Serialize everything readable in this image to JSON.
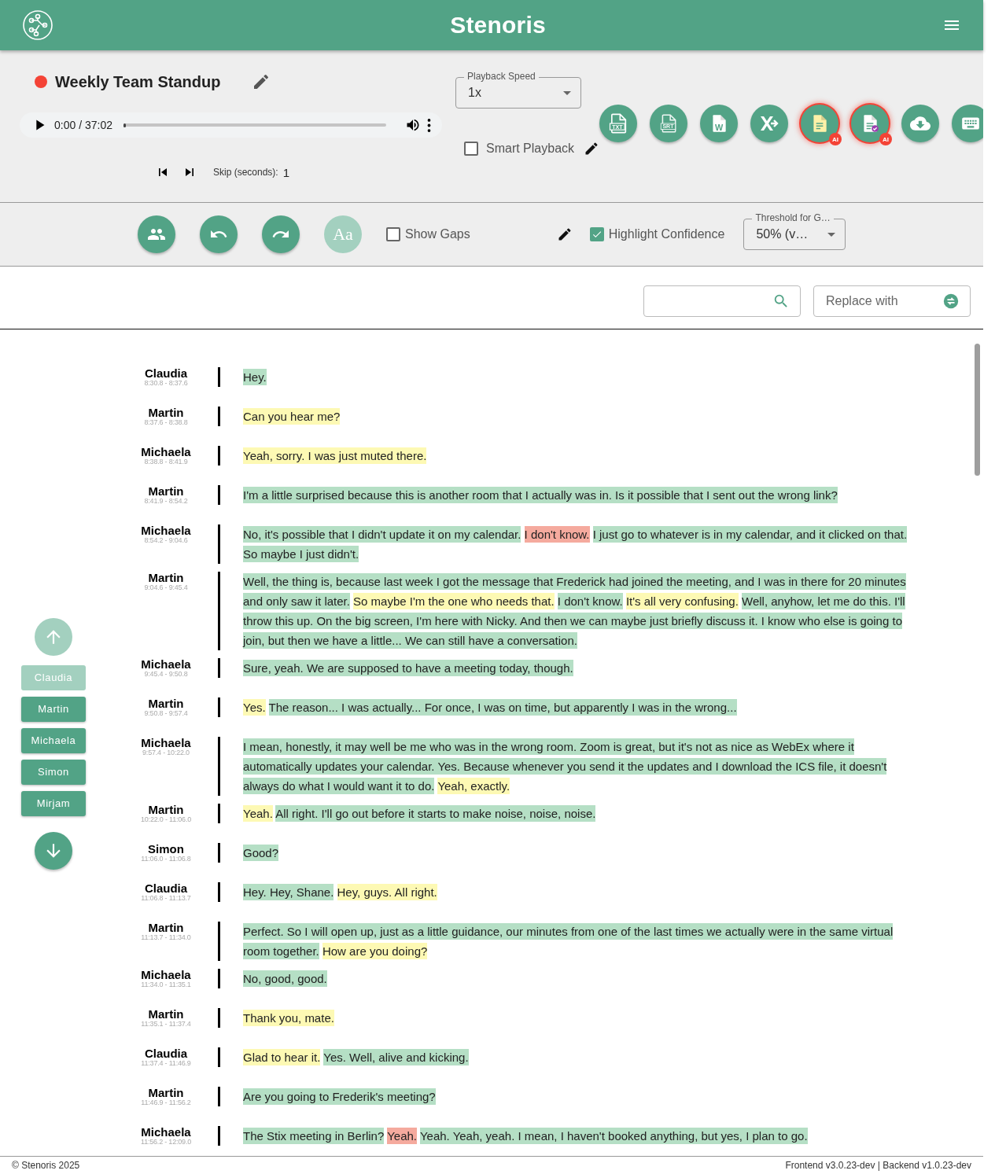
{
  "header": {
    "title": "Stenoris"
  },
  "recording": {
    "title": "Weekly Team Standup"
  },
  "player": {
    "time": "0:00 / 37:02",
    "level": 0
  },
  "skip": {
    "label": "Skip (seconds):",
    "value": "1"
  },
  "playback_speed": {
    "label": "Playback Speed",
    "value": "1x"
  },
  "smart_playback": {
    "label": "Smart Playback",
    "checked": false
  },
  "export_buttons": [
    {
      "kind": "txt",
      "label": "TXT",
      "highlighted": false
    },
    {
      "kind": "srt",
      "label": "SRT",
      "highlighted": false
    },
    {
      "kind": "docx",
      "label": "W",
      "highlighted": false
    },
    {
      "kind": "xls",
      "highlighted": false
    },
    {
      "kind": "summary",
      "badge": "AI",
      "highlighted": true
    },
    {
      "kind": "review",
      "badge": "AI",
      "highlighted": true
    },
    {
      "kind": "download",
      "highlighted": false
    },
    {
      "kind": "keyboard",
      "highlighted": false
    }
  ],
  "tools": [
    {
      "kind": "speakers",
      "disabled": false
    },
    {
      "kind": "undo",
      "disabled": false
    },
    {
      "kind": "redo",
      "disabled": false
    },
    {
      "kind": "font",
      "label": "Aa",
      "disabled": true
    }
  ],
  "show_gaps": {
    "label": "Show Gaps",
    "checked": false
  },
  "highlight_confidence": {
    "label": "Highlight Confidence",
    "checked": true
  },
  "threshold": {
    "label": "Threshold for G…",
    "value": "50% (v…"
  },
  "replace": {
    "placeholder": "Replace with"
  },
  "speaker_nav": {
    "up_disabled": true,
    "down_disabled": false,
    "speakers": [
      {
        "name": "Claudia",
        "selected": true
      },
      {
        "name": "Martin",
        "selected": false
      },
      {
        "name": "Michaela",
        "selected": false
      },
      {
        "name": "Simon",
        "selected": false
      },
      {
        "name": "Mirjam",
        "selected": false
      }
    ]
  },
  "transcript": [
    {
      "speaker": "Claudia",
      "time": "8:30.8 - 8:37.6",
      "segments": [
        {
          "text": "Hey.",
          "color": "#b5dfc5"
        }
      ]
    },
    {
      "speaker": "Martin",
      "time": "8:37.6 - 8:38.8",
      "segments": [
        {
          "text": "Can you hear me?",
          "color": "#fdf9b4"
        }
      ]
    },
    {
      "speaker": "Michaela",
      "time": "8:38.8 - 8:41.9",
      "segments": [
        {
          "text": "Yeah, sorry. I was just muted there.",
          "color": "#fdf9b4"
        }
      ]
    },
    {
      "speaker": "Martin",
      "time": "8:41.9 - 8:54.2",
      "segments": [
        {
          "text": "I'm a little surprised because this is another room that I actually was in. Is it possible that I sent out the wrong link?",
          "color": "#b5dfc5"
        }
      ]
    },
    {
      "speaker": "Michaela",
      "time": "8:54.2 - 9:04.6",
      "segments": [
        {
          "text": "No, it's possible that I didn't update it on my calendar.",
          "color": "#b5dfc5"
        },
        {
          "text": "I don't know.",
          "color": "#f5aa9e"
        },
        {
          "text": "I just go to whatever is in my calendar, and it clicked on that. So maybe I just didn't.",
          "color": "#b5dfc5"
        }
      ]
    },
    {
      "speaker": "Martin",
      "time": "9:04.6 - 9:45.4",
      "segments": [
        {
          "text": "Well, the thing is, because last week I got the message that Frederick had joined the meeting, and I was in there for 20 minutes and only saw it later.",
          "color": "#b5dfc5"
        },
        {
          "text": "So maybe I'm the one who needs that.",
          "color": "#fdf9b4"
        },
        {
          "text": "I don't know.",
          "color": "#b5dfc5"
        },
        {
          "text": "It's all very confusing.",
          "color": "#fdf9b4"
        },
        {
          "text": "Well, anyhow, let me do this. I'll throw this up. On the big screen, I'm here with Nicky. And then we can maybe just briefly discuss it. I know who else is going to join, but then we have a little... We can still have a conversation.",
          "color": "#b5dfc5"
        }
      ]
    },
    {
      "speaker": "Michaela",
      "time": "9:45.4 - 9:50.8",
      "segments": [
        {
          "text": "Sure, yeah. We are supposed to have a meeting today, though.",
          "color": "#b5dfc5"
        }
      ]
    },
    {
      "speaker": "Martin",
      "time": "9:50.8 - 9:57.4",
      "segments": [
        {
          "text": "Yes.",
          "color": "#fdf9b4"
        },
        {
          "text": "The reason... I was actually... For once, I was on time, but apparently I was in the wrong...",
          "color": "#b5dfc5"
        }
      ]
    },
    {
      "speaker": "Michaela",
      "time": "9:57.4 - 10:22.0",
      "segments": [
        {
          "text": "I mean, honestly, it may well be me who was in the wrong room. Zoom is great, but it's not as nice as WebEx where it automatically updates your calendar. Yes. Because whenever you send it the updates and I download the ICS file, it doesn't always do what I would want it to do.",
          "color": "#b5dfc5"
        },
        {
          "text": "Yeah, exactly.",
          "color": "#fdf9b4"
        }
      ]
    },
    {
      "speaker": "Martin",
      "time": "10:22.0 - 11:06.0",
      "segments": [
        {
          "text": "Yeah.",
          "color": "#fdf9b4"
        },
        {
          "text": "All right. I'll go out before it starts to make noise, noise, noise.",
          "color": "#b5dfc5"
        }
      ]
    },
    {
      "speaker": "Simon",
      "time": "11:06.0 - 11:06.8",
      "segments": [
        {
          "text": "Good?",
          "color": "#b5dfc5"
        }
      ]
    },
    {
      "speaker": "Claudia",
      "time": "11:06.8 - 11:13.7",
      "segments": [
        {
          "text": "Hey. Hey, Shane.",
          "color": "#b5dfc5"
        },
        {
          "text": "Hey, guys. All right.",
          "color": "#fdf9b4"
        }
      ]
    },
    {
      "speaker": "Martin",
      "time": "11:13.7 - 11:34.0",
      "segments": [
        {
          "text": "Perfect. So I will open up, just as a little guidance, our minutes from one of the last times we actually were in the same virtual room together.",
          "color": "#b5dfc5"
        },
        {
          "text": "How are you doing?",
          "color": "#fdf9b4"
        }
      ]
    },
    {
      "speaker": "Michaela",
      "time": "11:34.0 - 11:35.1",
      "segments": [
        {
          "text": "No, good, good.",
          "color": "#b5dfc5"
        }
      ]
    },
    {
      "speaker": "Martin",
      "time": "11:35.1 - 11:37.4",
      "segments": [
        {
          "text": "Thank you, mate.",
          "color": "#fdf9b4"
        }
      ]
    },
    {
      "speaker": "Claudia",
      "time": "11:37.4 - 11:46.9",
      "segments": [
        {
          "text": "Glad to hear it.",
          "color": "#fdf9b4"
        },
        {
          "text": "Yes. Well, alive and kicking.",
          "color": "#b5dfc5"
        }
      ]
    },
    {
      "speaker": "Martin",
      "time": "11:46.9 - 11:56.2",
      "segments": [
        {
          "text": "Are you going to Frederik's meeting?",
          "color": "#b5dfc5"
        }
      ]
    },
    {
      "speaker": "Michaela",
      "time": "11:56.2 - 12:09.0",
      "segments": [
        {
          "text": "The Stix meeting in Berlin?",
          "color": "#b5dfc5"
        },
        {
          "text": "Yeah.",
          "color": "#f5aa9e"
        },
        {
          "text": "Yeah. Yeah, yeah. I mean, I haven't booked anything, but yes, I plan to go.",
          "color": "#b5dfc5"
        }
      ]
    }
  ],
  "footer": {
    "copyright": "© Stenoris 2025",
    "version": "Frontend v3.0.23-dev | Backend v1.0.23-dev"
  }
}
